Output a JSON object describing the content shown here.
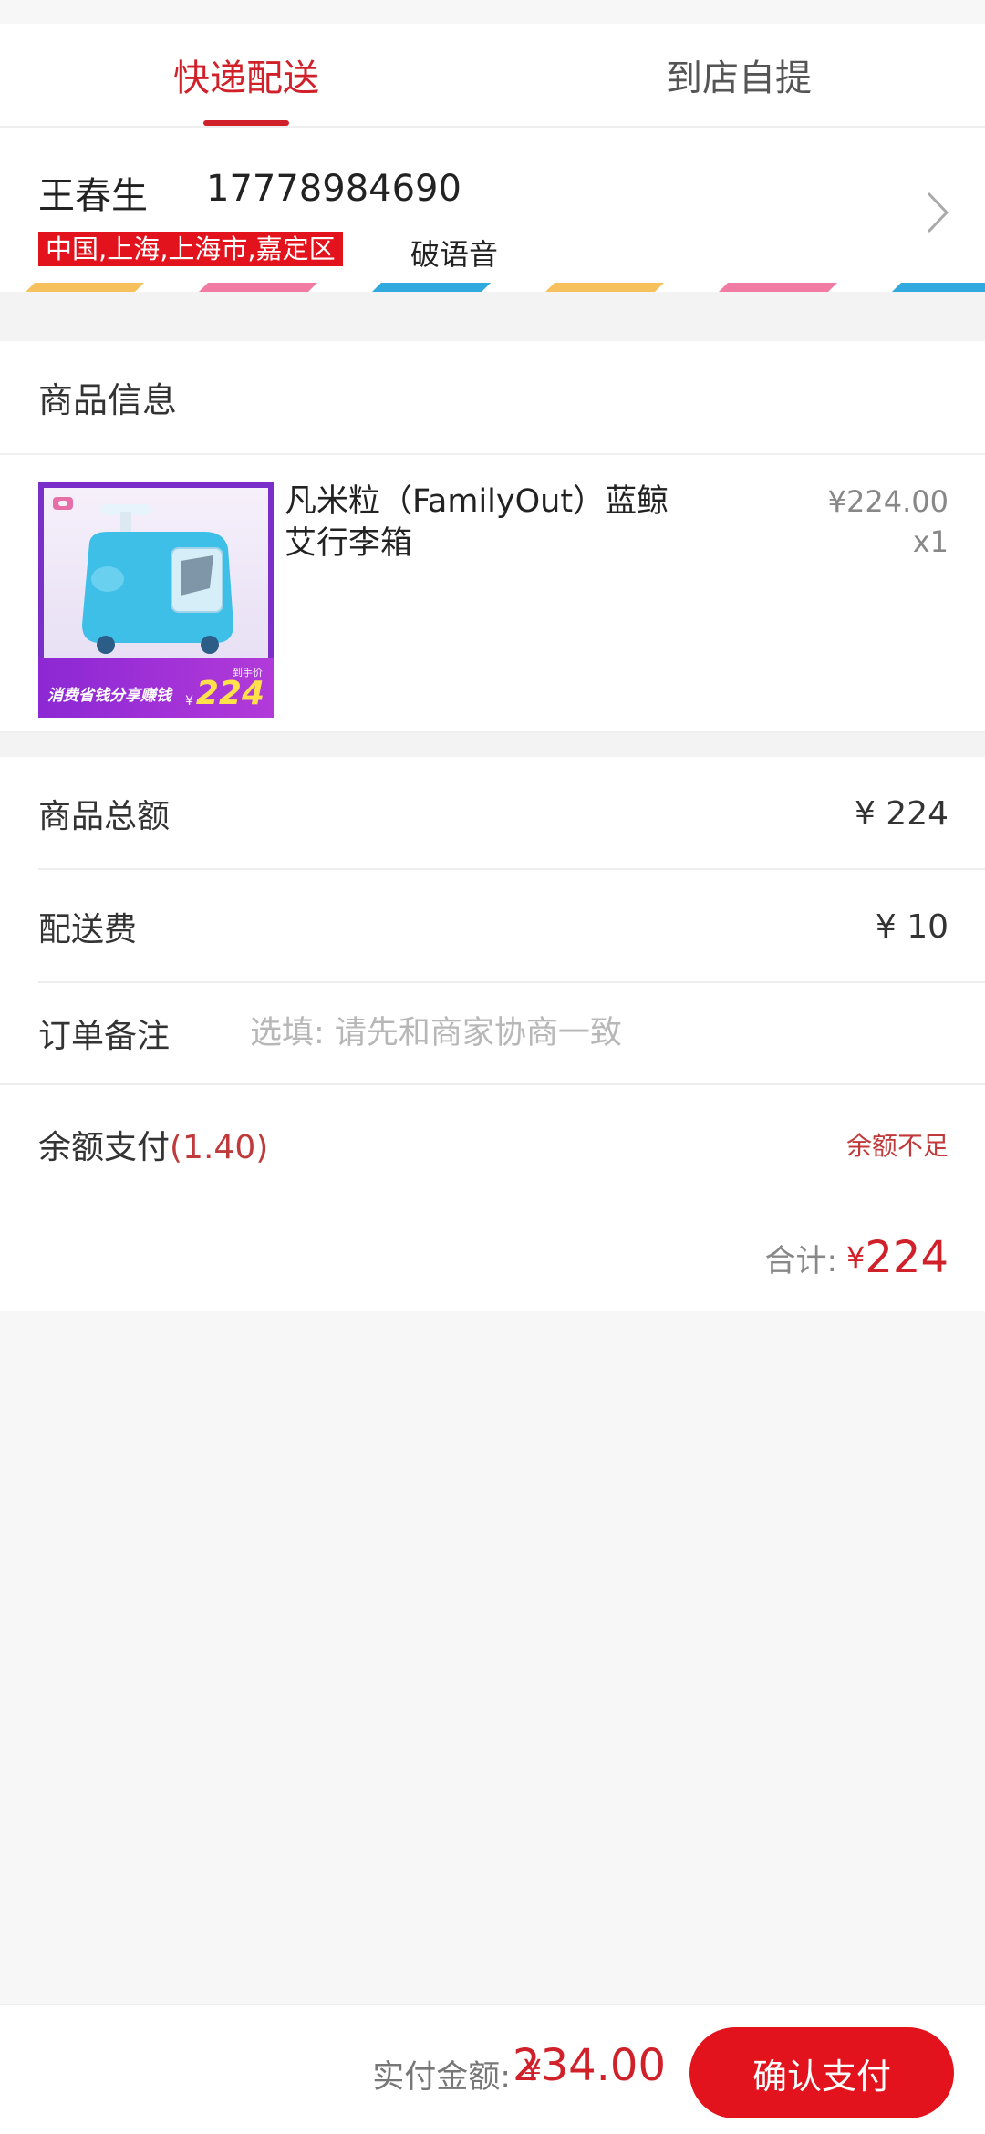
{
  "tabs": [
    {
      "label": "快递配送",
      "active": true
    },
    {
      "label": "到店自提",
      "active": false
    }
  ],
  "address": {
    "name": "王春生",
    "phone": "17778984690",
    "region": "中国,上海,上海市,嘉定区",
    "detail": "破语音"
  },
  "product_section": {
    "title": "商品信息",
    "items": [
      {
        "name": "凡米粒（FamilyOut）蓝鲸艾行李箱",
        "price": "¥224.00",
        "quantity": "x1",
        "image_caption": "消费省钱分享赚钱",
        "image_price_label": "到手价",
        "image_price_yen": "¥",
        "image_price": "224"
      }
    ]
  },
  "summary": {
    "goods_total_label": "商品总额",
    "goods_total_value": "¥ 224",
    "shipping_label": "配送费",
    "shipping_value": "¥ 10",
    "note_label": "订单备注",
    "note_placeholder": "选填: 请先和商家协商一致",
    "balance_label": "余额支付",
    "balance_amount": "(1.40)",
    "balance_status": "余额不足",
    "total_label": "合计:",
    "total_yen": "¥",
    "total_value": "224"
  },
  "footer": {
    "pay_label": "实付金额:",
    "pay_yen": "¥",
    "pay_amount": "234.00",
    "confirm_label": "确认支付"
  },
  "colors": {
    "accent": "#d0212a",
    "button": "#e2131c",
    "stripe_colors": [
      "#f6c15d",
      "#f27ba3",
      "#2fa9de"
    ]
  }
}
